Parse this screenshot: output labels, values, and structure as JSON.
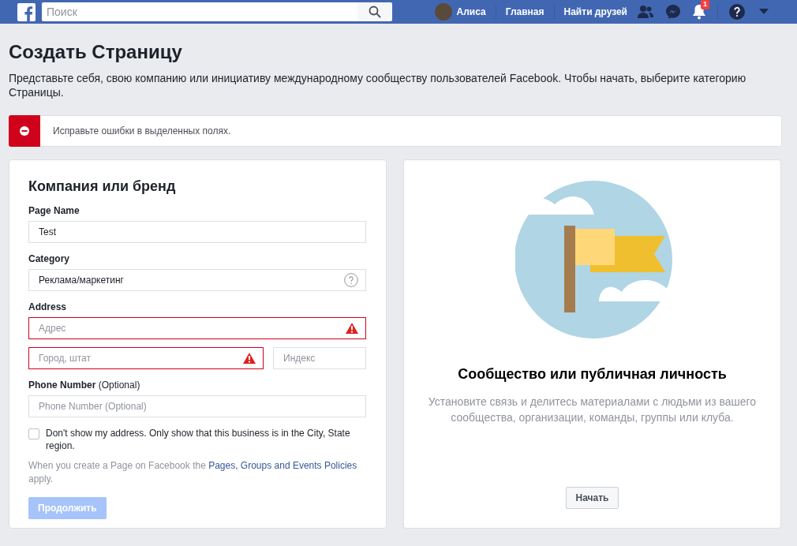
{
  "navbar": {
    "search_placeholder": "Поиск",
    "user_name": "Алиса",
    "links": [
      "Главная",
      "Найти друзей"
    ],
    "notification_count": "1"
  },
  "page": {
    "title": "Создать Страницу",
    "intro": "Представьте себя, свою компанию или инициативу международному сообществу пользователей Facebook. Чтобы начать, выберите категорию Страницы.",
    "error_banner": "Исправьте ошибки в выделенных полях."
  },
  "form_card": {
    "title": "Компания или бренд",
    "sections": [
      {
        "label": "Page Name",
        "rows": [
          [
            {
              "value": "Test",
              "error": false,
              "help": false
            }
          ]
        ]
      },
      {
        "label": "Category",
        "rows": [
          [
            {
              "value": "Реклама/маркетинг",
              "error": false,
              "help": true
            }
          ]
        ]
      },
      {
        "label": "Address",
        "rows": [
          [
            {
              "placeholder": "Адрес",
              "error": true,
              "help": false
            }
          ],
          [
            {
              "placeholder": "Город, штат",
              "error": true,
              "help": false
            },
            {
              "placeholder": "Индекс",
              "error": false,
              "help": false
            }
          ]
        ]
      },
      {
        "label": "Phone Number",
        "note": "(Optional)",
        "rows": [
          [
            {
              "placeholder": "Phone Number (Optional)",
              "error": false,
              "help": false
            }
          ]
        ]
      }
    ],
    "checkbox": {
      "label": "Don't show my address. Only show that this business is in the City, State region.",
      "checked": false
    },
    "policy": {
      "before": "When you create a Page on Facebook the",
      "link": "Pages, Groups and Events Policies",
      "after": "apply."
    },
    "submit": {
      "label": "Продолжить",
      "disabled": true
    }
  },
  "community_card": {
    "title": "Сообщество или публичная личность",
    "description": "Установите связь и делитесь материалами с людьми из вашего сообщества, организации, команды, группы или клуба.",
    "button": "Начать"
  }
}
